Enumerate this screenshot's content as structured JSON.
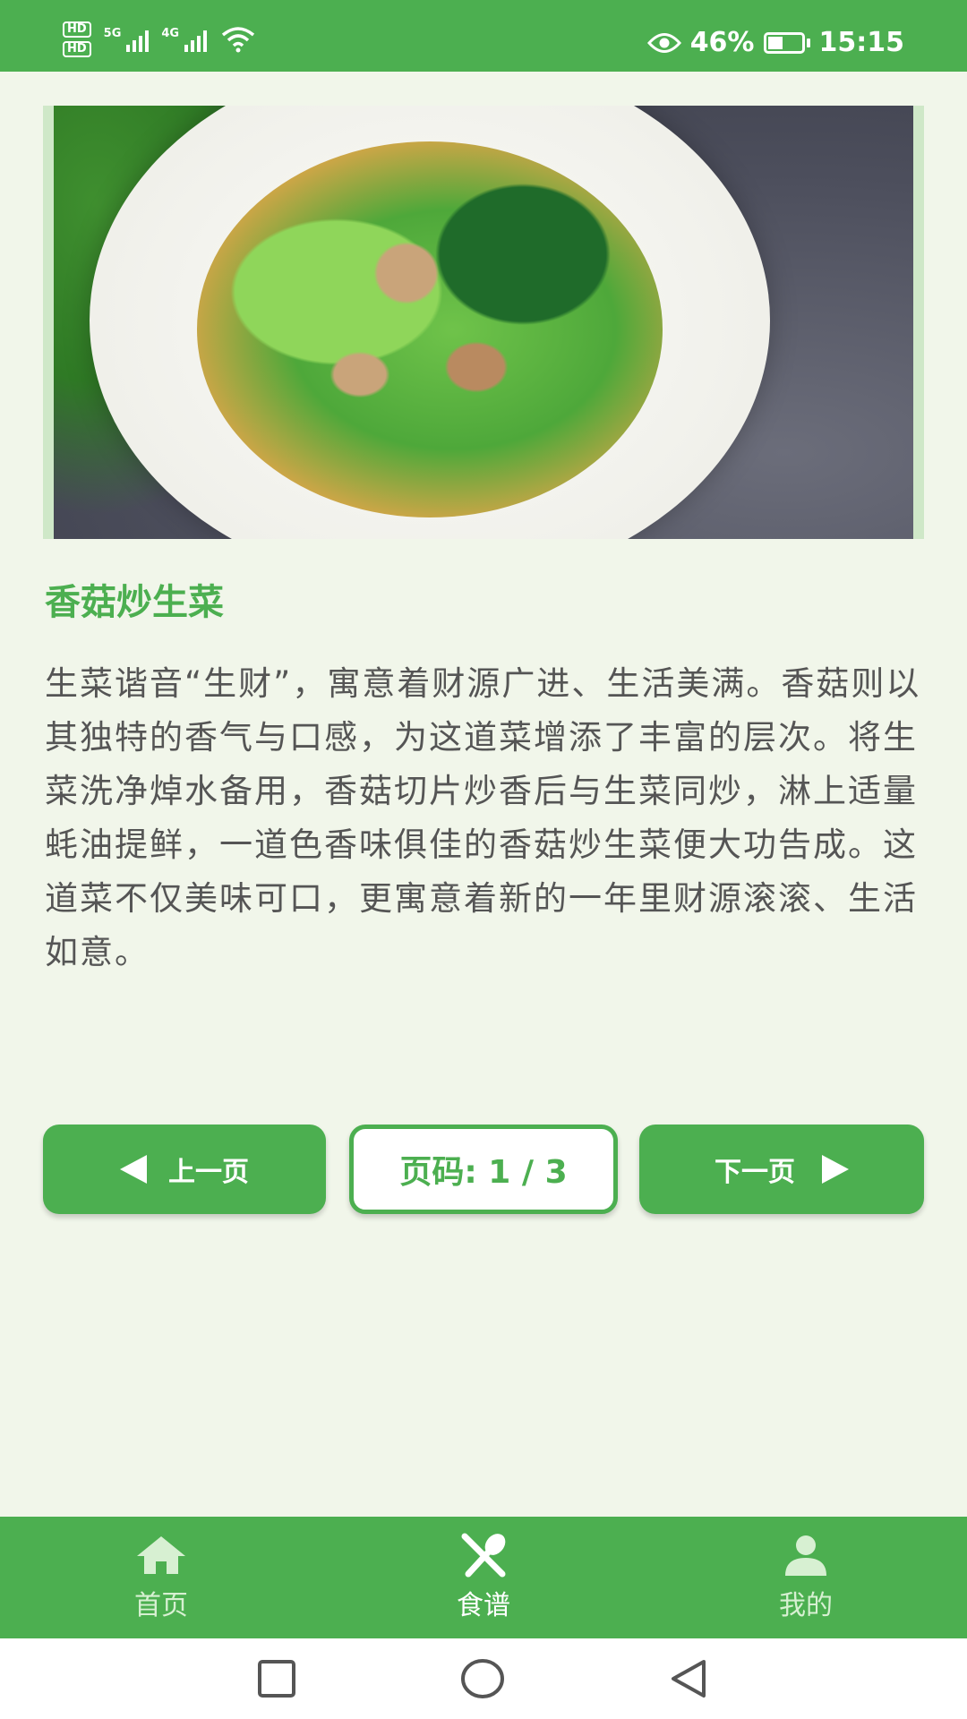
{
  "status_bar": {
    "sim1_label": "HD",
    "sim2_label": "HD",
    "network1": "5G",
    "network2": "4G",
    "battery_percent": "46%",
    "battery_level": 0.46,
    "time": "15:15",
    "icons": [
      "eye-icon",
      "wifi-icon",
      "signal-icon",
      "battery-icon"
    ]
  },
  "recipe": {
    "image_alt": "香菇炒生菜",
    "title": "香菇炒生菜",
    "description": "生菜谐音“生财”，寓意着财源广进、生活美满。香菇则以其独特的香气与口感，为这道菜增添了丰富的层次。将生菜洗净焯水备用，香菇切片炒香后与生菜同炒，淋上适量蚝油提鲜，一道色香味俱佳的香菇炒生菜便大功告成。这道菜不仅美味可口，更寓意着新的一年里财源滚滚、生活如意。"
  },
  "pager": {
    "prev_label": "上一页",
    "next_label": "下一页",
    "page_indicator": "页码: 1 / 3"
  },
  "bottom_nav": {
    "tabs": [
      {
        "label": "首页",
        "icon": "home-icon",
        "active": false
      },
      {
        "label": "食谱",
        "icon": "utensils-icon",
        "active": true
      },
      {
        "label": "我的",
        "icon": "person-icon",
        "active": false
      }
    ]
  },
  "colors": {
    "primary": "#4caf50",
    "background": "#f1f6ea",
    "text": "#555555"
  }
}
